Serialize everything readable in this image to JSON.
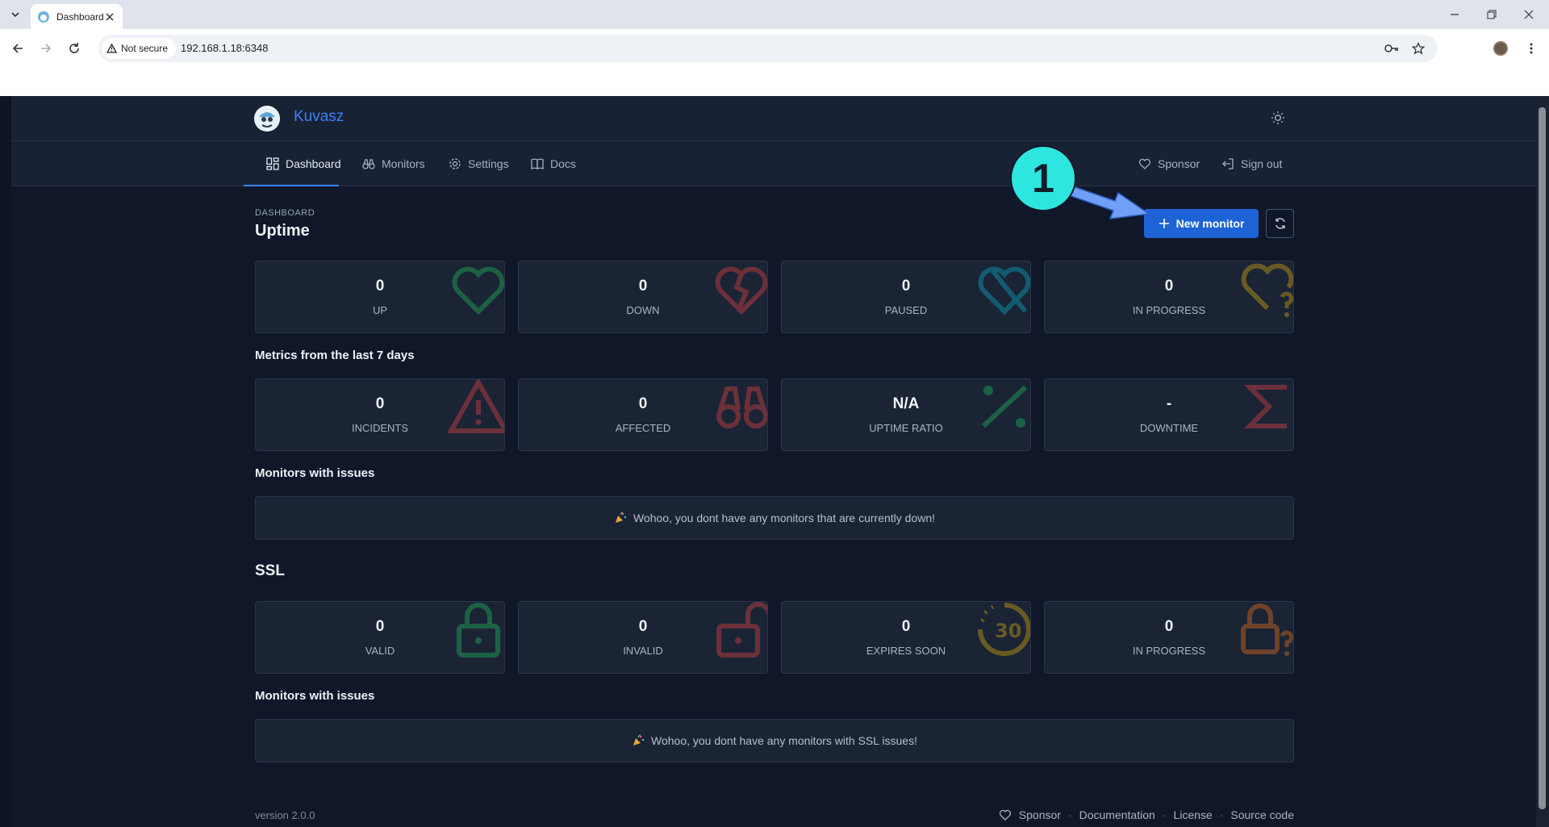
{
  "browser": {
    "tab_title": "Dashboard",
    "security_label": "Not secure",
    "url": "192.168.1.18:6348"
  },
  "app": {
    "brand": "Kuvasz",
    "nav": [
      {
        "label": "Dashboard",
        "icon": "dashboard-icon"
      },
      {
        "label": "Monitors",
        "icon": "binoculars-icon"
      },
      {
        "label": "Settings",
        "icon": "gear-icon"
      },
      {
        "label": "Docs",
        "icon": "book-icon"
      }
    ],
    "nav_right": [
      {
        "label": "Sponsor",
        "icon": "heart-icon"
      },
      {
        "label": "Sign out",
        "icon": "logout-icon"
      }
    ]
  },
  "header": {
    "pretitle": "DASHBOARD",
    "title": "Uptime",
    "new_monitor_label": "New monitor",
    "annotation_number": "1"
  },
  "uptime_cards": [
    {
      "value": "0",
      "label": "UP",
      "icon": "heart-icon",
      "color": "#22c55e"
    },
    {
      "value": "0",
      "label": "DOWN",
      "icon": "broken-heart-icon",
      "color": "#ef4444"
    },
    {
      "value": "0",
      "label": "PAUSED",
      "icon": "paused-heart-icon",
      "color": "#06b6d4"
    },
    {
      "value": "0",
      "label": "IN PROGRESS",
      "icon": "question-heart-icon",
      "color": "#eab308"
    }
  ],
  "metrics": {
    "heading": "Metrics from the last 7 days",
    "cards": [
      {
        "value": "0",
        "label": "INCIDENTS",
        "icon": "warning-icon",
        "color": "#ef4444"
      },
      {
        "value": "0",
        "label": "AFFECTED",
        "icon": "binoculars-icon",
        "color": "#ef4444"
      },
      {
        "value": "N/A",
        "label": "UPTIME RATIO",
        "icon": "percent-icon",
        "color": "#22c55e"
      },
      {
        "value": "-",
        "label": "DOWNTIME",
        "icon": "sigma-icon",
        "color": "#ef4444"
      }
    ]
  },
  "issues_uptime": {
    "heading": "Monitors with issues",
    "message": "Wohoo, you dont have any monitors that are currently down!"
  },
  "ssl": {
    "heading": "SSL",
    "cards": [
      {
        "value": "0",
        "label": "VALID",
        "icon": "lock-icon",
        "color": "#22c55e"
      },
      {
        "value": "0",
        "label": "INVALID",
        "icon": "unlock-icon",
        "color": "#ef4444"
      },
      {
        "value": "0",
        "label": "EXPIRES SOON",
        "icon": "clock-30-icon",
        "color": "#eab308"
      },
      {
        "value": "0",
        "label": "IN PROGRESS",
        "icon": "lock-question-icon",
        "color": "#f97316"
      }
    ]
  },
  "issues_ssl": {
    "heading": "Monitors with issues",
    "message": "Wohoo, you dont have any monitors with SSL issues!"
  },
  "footer": {
    "version": "version 2.0.0",
    "links": [
      "Sponsor",
      "Documentation",
      "License",
      "Source code"
    ],
    "separator": "·"
  }
}
